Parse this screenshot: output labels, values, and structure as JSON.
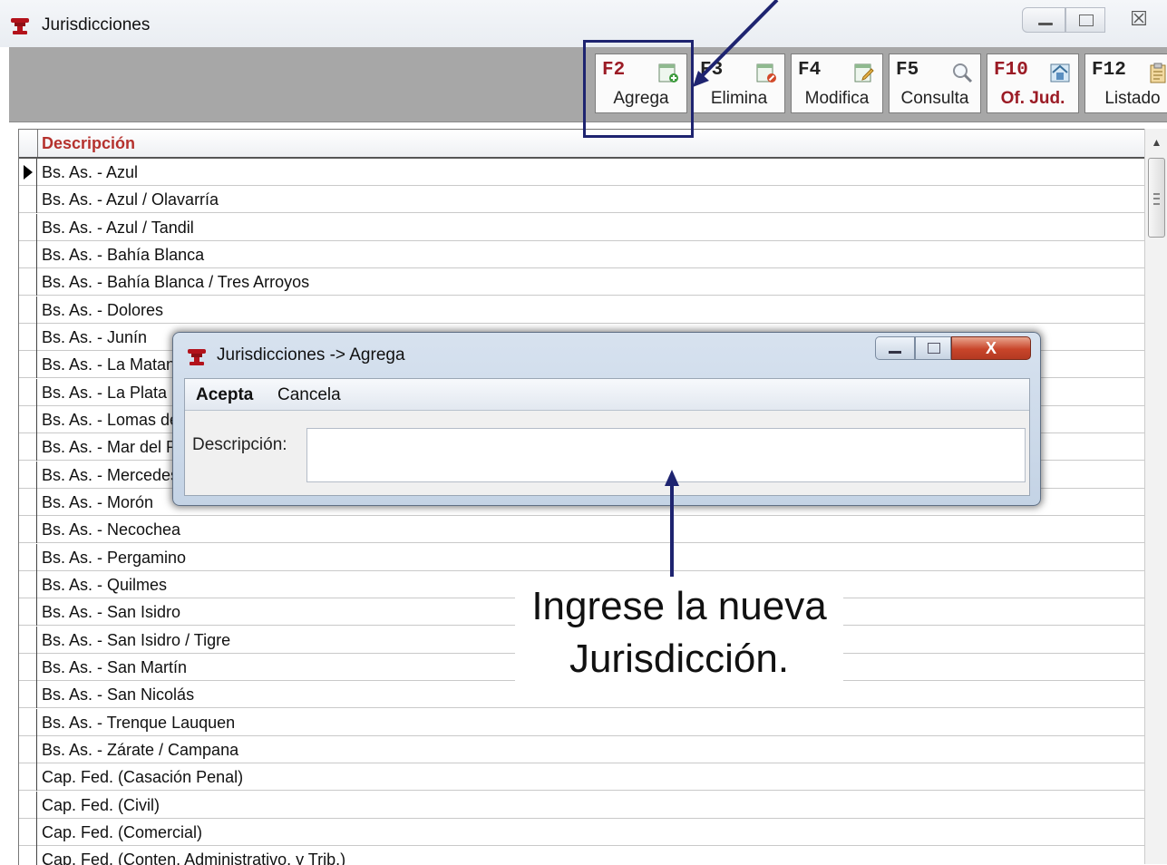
{
  "window": {
    "title": "Jurisdicciones",
    "close_glyph": "☒"
  },
  "toolbar": {
    "buttons": [
      {
        "key": "F2",
        "label": "Agrega",
        "icon": "add-document-icon"
      },
      {
        "key": "F3",
        "label": "Elimina",
        "icon": "delete-document-icon"
      },
      {
        "key": "F4",
        "label": "Modifica",
        "icon": "edit-document-icon"
      },
      {
        "key": "F5",
        "label": "Consulta",
        "icon": "magnifier-icon"
      },
      {
        "key": "F10",
        "label": "Of. Jud.",
        "icon": "building-icon"
      },
      {
        "key": "F12",
        "label": "Listado",
        "icon": "clipboard-icon"
      }
    ]
  },
  "grid": {
    "column": "Descripción",
    "rows": [
      "Bs. As. - Azul",
      "Bs. As. - Azul / Olavarría",
      "Bs. As. - Azul / Tandil",
      "Bs. As. - Bahía Blanca",
      "Bs. As. - Bahía Blanca / Tres Arroyos",
      "Bs. As. - Dolores",
      "Bs. As. - Junín",
      "Bs. As. - La Matanza",
      "Bs. As. - La Plata",
      "Bs. As. - Lomas de Zamora",
      "Bs. As. - Mar del Plata",
      "Bs. As. - Mercedes",
      "Bs. As. - Morón",
      "Bs. As. - Necochea",
      "Bs. As. - Pergamino",
      "Bs. As. - Quilmes",
      "Bs. As. - San Isidro",
      "Bs. As. - San Isidro / Tigre",
      "Bs. As. - San Martín",
      "Bs. As. - San Nicolás",
      "Bs. As. - Trenque Lauquen",
      "Bs. As. - Zárate / Campana",
      "Cap. Fed. (Casación Penal)",
      "Cap. Fed. (Civil)",
      "Cap. Fed. (Comercial)",
      "Cap. Fed. (Conten. Administrativo. y Trib.)"
    ]
  },
  "dialog": {
    "title": "Jurisdicciones -> Agrega",
    "close_glyph": "X",
    "menu": {
      "accept": "Acepta",
      "cancel": "Cancela"
    },
    "field_label": "Descripción:",
    "field_value": ""
  },
  "annotation": {
    "line1": "Ingrese la nueva",
    "line2": "Jurisdicción."
  },
  "colors": {
    "highlight": "#1e2470",
    "header_text": "#b5312d",
    "toolbar_bg": "#a7a7a7"
  }
}
